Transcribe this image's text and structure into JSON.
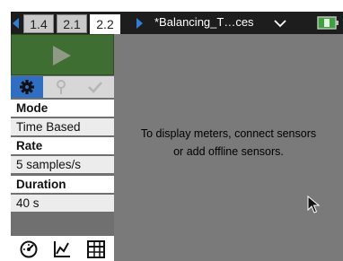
{
  "header": {
    "tabs": [
      {
        "label": "1.4",
        "active": false
      },
      {
        "label": "2.1",
        "active": false
      },
      {
        "label": "2.2",
        "active": true
      }
    ],
    "document_title": "*Balancing_T…ces",
    "close_label": "x"
  },
  "sidebar": {
    "tools": [
      "gear-icon",
      "pin-icon",
      "check-icon"
    ],
    "settings": [
      {
        "label": "Mode",
        "value": "Time Based"
      },
      {
        "label": "Rate",
        "value": "5 samples/s"
      },
      {
        "label": "Duration",
        "value": "40 s"
      }
    ],
    "view_buttons": [
      "meter-view-icon",
      "graph-view-icon",
      "table-view-icon"
    ]
  },
  "main": {
    "message_line1": "To display meters, connect sensors",
    "message_line2": "or add offline sensors."
  },
  "colors": {
    "accent": "#2e6fc4",
    "play_green": "#3f6e32",
    "main_bg": "#7a7a7a",
    "close_red": "#c3272b"
  }
}
